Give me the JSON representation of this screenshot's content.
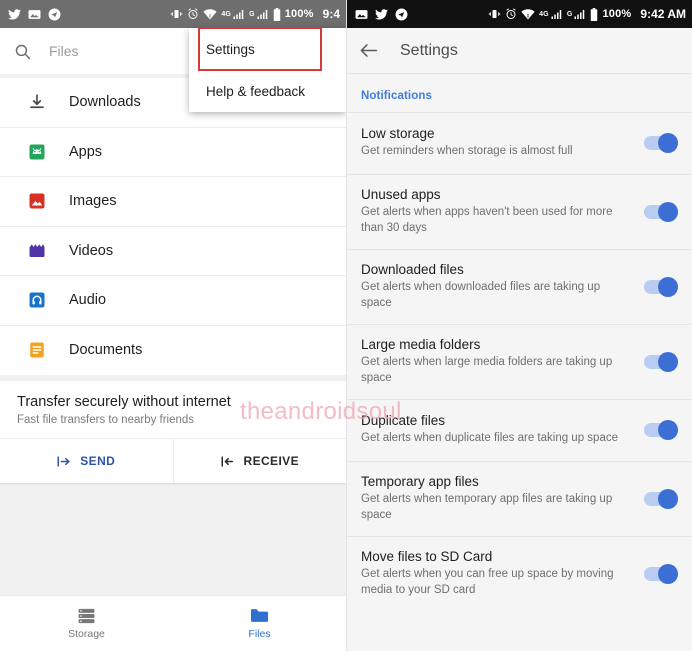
{
  "left": {
    "statusbar": {
      "icons": [
        "twitter-icon",
        "gallery-icon",
        "telegram-icon"
      ],
      "vibrate_icon": "vibrate-icon",
      "alarm_icon": "alarm-icon",
      "wifi_icon": "wifi-icon",
      "net4g_label": "4G",
      "signal1_icon": "signal-bars-icon",
      "netg_label": "G",
      "signal2_icon": "signal-bars-icon",
      "battery_icon": "battery-full-icon",
      "battery_label": "100%",
      "time": "9:4"
    },
    "search": {
      "icon": "search-icon",
      "text": "Files"
    },
    "file_list": [
      {
        "label": "Downloads",
        "icon": "download-icon",
        "color": "#4a4a4a"
      },
      {
        "label": "Apps",
        "icon": "android-apps-icon",
        "color": "#23a45c"
      },
      {
        "label": "Images",
        "icon": "image-icon",
        "color": "#d93025"
      },
      {
        "label": "Videos",
        "icon": "video-icon",
        "color": "#5233a8"
      },
      {
        "label": "Audio",
        "icon": "audio-icon",
        "color": "#1a73c8"
      },
      {
        "label": "Documents",
        "icon": "document-icon",
        "color": "#f0a41e"
      }
    ],
    "transfer_card": {
      "title": "Transfer securely without internet",
      "subtitle": "Fast file transfers to nearby friends",
      "send_label": "SEND",
      "send_icon": "arrow-right-icon",
      "receive_label": "RECEIVE",
      "receive_icon": "arrow-left-icon"
    },
    "menu": {
      "items": [
        {
          "label": "Settings",
          "highlighted": true
        },
        {
          "label": "Help & feedback",
          "highlighted": false
        }
      ],
      "highlight_color": "#d23b3b"
    },
    "bottom_nav": [
      {
        "label": "Storage",
        "icon": "storage-icon",
        "active": false
      },
      {
        "label": "Files",
        "icon": "folder-icon",
        "active": true
      }
    ]
  },
  "right": {
    "statusbar": {
      "icons": [
        "gallery-icon",
        "twitter-icon",
        "telegram-icon"
      ],
      "vibrate_icon": "vibrate-icon",
      "alarm_icon": "alarm-icon",
      "wifi_icon": "wifi-icon",
      "net4g_label": "4G",
      "signal1_icon": "signal-bars-icon",
      "netg_label": "G",
      "signal2_icon": "signal-bars-icon",
      "battery_icon": "battery-full-icon",
      "battery_label": "100%",
      "time": "9:42 AM"
    },
    "appbar": {
      "back_icon": "back-arrow-icon",
      "title": "Settings"
    },
    "section_title": "Notifications",
    "accent_color": "#3f7ddb",
    "settings": [
      {
        "title": "Low storage",
        "subtitle": "Get reminders when storage is almost full",
        "enabled": true
      },
      {
        "title": "Unused apps",
        "subtitle": "Get alerts when apps haven't been used for more than 30 days",
        "enabled": true
      },
      {
        "title": "Downloaded files",
        "subtitle": "Get alerts when downloaded files are taking up space",
        "enabled": true
      },
      {
        "title": "Large media folders",
        "subtitle": "Get alerts when large media folders are taking up space",
        "enabled": true
      },
      {
        "title": "Duplicate files",
        "subtitle": "Get alerts when duplicate files are taking up space",
        "enabled": true
      },
      {
        "title": "Temporary app files",
        "subtitle": "Get alerts when temporary app files are taking up space",
        "enabled": true
      },
      {
        "title": "Move files to SD Card",
        "subtitle": "Get alerts when you can free up space by moving media to your SD card",
        "enabled": true
      }
    ]
  },
  "watermark": "theandroidsoul"
}
